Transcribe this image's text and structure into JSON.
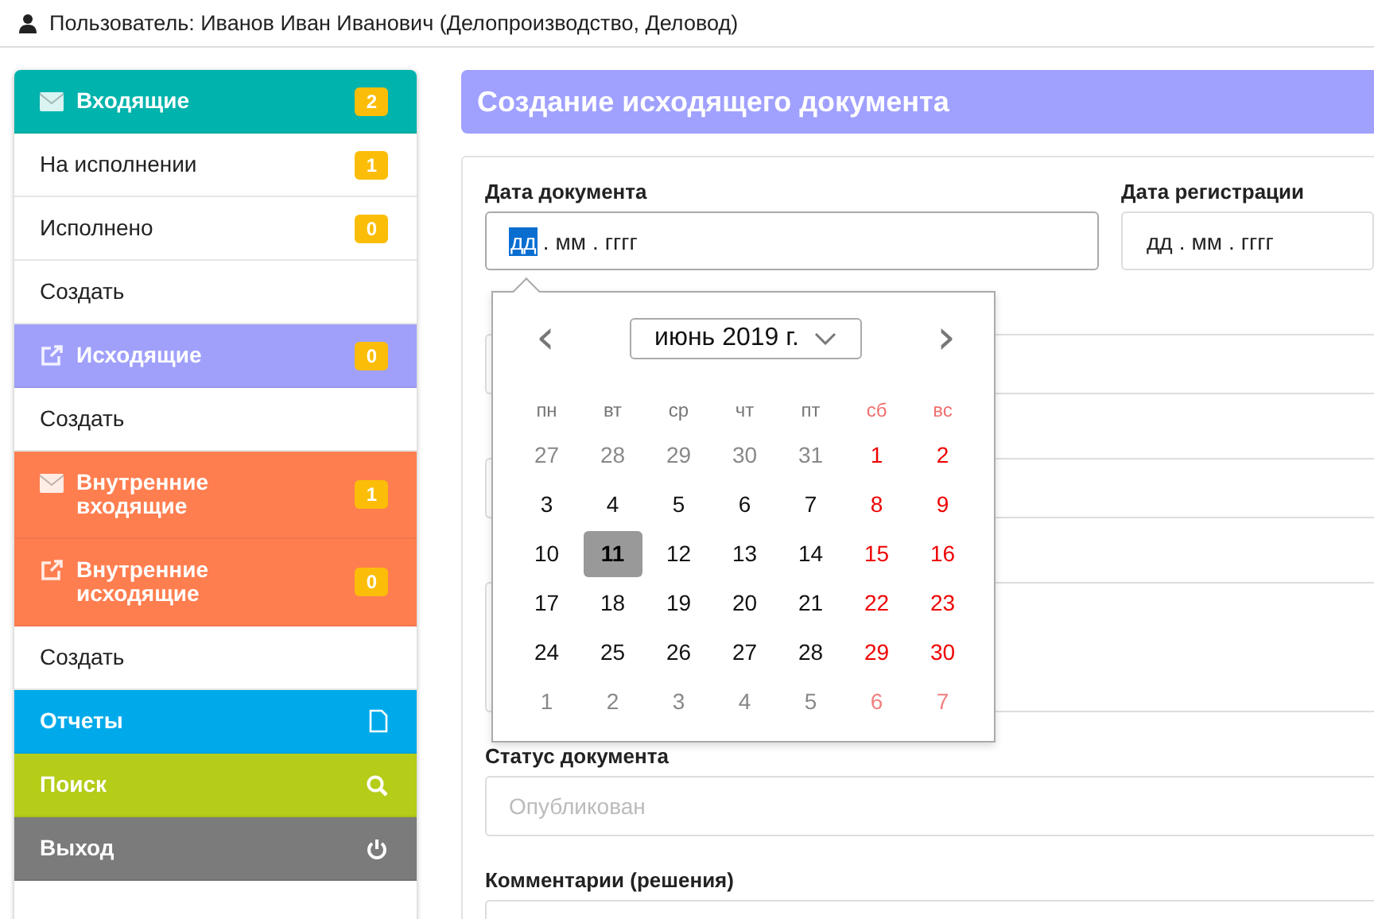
{
  "header": {
    "user_text": "Пользователь: Иванов Иван Иванович (Делопроизводство, Деловод)"
  },
  "sidebar": {
    "items": [
      {
        "label": "Входящие",
        "kind": "section",
        "color": "#00b3ad",
        "badge": "2"
      },
      {
        "label": "На исполнении",
        "kind": "link",
        "badge": "1"
      },
      {
        "label": "Исполнено",
        "kind": "link",
        "badge": "0"
      },
      {
        "label": "Создать",
        "kind": "link"
      },
      {
        "label": "Исходящие",
        "kind": "section",
        "color": "#a0a0fb",
        "badge": "0"
      },
      {
        "label": "Создать",
        "kind": "link"
      },
      {
        "label": "Внутренние входящие",
        "kind": "section",
        "color": "#ff7e50",
        "badge": "1"
      },
      {
        "label": "Внутренние исходящие",
        "kind": "section",
        "color": "#ff7e50",
        "badge": "0"
      },
      {
        "label": "Создать",
        "kind": "link"
      },
      {
        "label": "Отчеты",
        "kind": "tool",
        "color": "#00aaea"
      },
      {
        "label": "Поиск",
        "kind": "tool",
        "color": "#b5cc18"
      },
      {
        "label": "Выход",
        "kind": "tool",
        "color": "#7b7b7b"
      }
    ]
  },
  "main": {
    "title": "Создание исходящего документа",
    "date_fields": [
      {
        "label": "Дата документа",
        "focused": true,
        "separator": ".",
        "segments": [
          {
            "text": "дд",
            "selected": true
          },
          {
            "text": "мм",
            "selected": false
          },
          {
            "text": "гггг",
            "selected": false
          }
        ]
      },
      {
        "label": "Дата регистрации",
        "focused": false,
        "separator": ".",
        "segments": [
          {
            "text": "дд",
            "selected": false
          },
          {
            "text": "мм",
            "selected": false
          },
          {
            "text": "гггг",
            "selected": false
          }
        ]
      }
    ],
    "fields": [
      {
        "kind": "input"
      },
      {
        "kind": "input"
      },
      {
        "kind": "textarea"
      },
      {
        "label": "Статус документа",
        "kind": "input",
        "placeholder": "Опубликован"
      },
      {
        "label": "Комментарии (решения)",
        "kind": "input"
      }
    ]
  },
  "date_picker": {
    "month": "июнь 2019 г.",
    "prev": "‹",
    "next": "›",
    "weekdays": [
      {
        "label": "пн",
        "weekend": false
      },
      {
        "label": "вт",
        "weekend": false
      },
      {
        "label": "ср",
        "weekend": false
      },
      {
        "label": "чт",
        "weekend": false
      },
      {
        "label": "пт",
        "weekend": false
      },
      {
        "label": "сб",
        "weekend": true
      },
      {
        "label": "вс",
        "weekend": true
      }
    ],
    "weeks": [
      [
        {
          "day": "27",
          "muted": true,
          "selected": false
        },
        {
          "day": "28",
          "muted": true,
          "selected": false
        },
        {
          "day": "29",
          "muted": true,
          "selected": false
        },
        {
          "day": "30",
          "muted": true,
          "selected": false
        },
        {
          "day": "31",
          "muted": true,
          "selected": false
        },
        {
          "day": "1",
          "muted": false,
          "selected": false
        },
        {
          "day": "2",
          "muted": false,
          "selected": false
        }
      ],
      [
        {
          "day": "3",
          "muted": false,
          "selected": false
        },
        {
          "day": "4",
          "muted": false,
          "selected": false
        },
        {
          "day": "5",
          "muted": false,
          "selected": false
        },
        {
          "day": "6",
          "muted": false,
          "selected": false
        },
        {
          "day": "7",
          "muted": false,
          "selected": false
        },
        {
          "day": "8",
          "muted": false,
          "selected": false
        },
        {
          "day": "9",
          "muted": false,
          "selected": false
        }
      ],
      [
        {
          "day": "10",
          "muted": false,
          "selected": false
        },
        {
          "day": "11",
          "muted": false,
          "selected": true
        },
        {
          "day": "12",
          "muted": false,
          "selected": false
        },
        {
          "day": "13",
          "muted": false,
          "selected": false
        },
        {
          "day": "14",
          "muted": false,
          "selected": false
        },
        {
          "day": "15",
          "muted": false,
          "selected": false
        },
        {
          "day": "16",
          "muted": false,
          "selected": false
        }
      ],
      [
        {
          "day": "17",
          "muted": false,
          "selected": false
        },
        {
          "day": "18",
          "muted": false,
          "selected": false
        },
        {
          "day": "19",
          "muted": false,
          "selected": false
        },
        {
          "day": "20",
          "muted": false,
          "selected": false
        },
        {
          "day": "21",
          "muted": false,
          "selected": false
        },
        {
          "day": "22",
          "muted": false,
          "selected": false
        },
        {
          "day": "23",
          "muted": false,
          "selected": false
        }
      ],
      [
        {
          "day": "24",
          "muted": false,
          "selected": false
        },
        {
          "day": "25",
          "muted": false,
          "selected": false
        },
        {
          "day": "26",
          "muted": false,
          "selected": false
        },
        {
          "day": "27",
          "muted": false,
          "selected": false
        },
        {
          "day": "28",
          "muted": false,
          "selected": false
        },
        {
          "day": "29",
          "muted": false,
          "selected": false
        },
        {
          "day": "30",
          "muted": false,
          "selected": false
        }
      ],
      [
        {
          "day": "1",
          "muted": true,
          "selected": false
        },
        {
          "day": "2",
          "muted": true,
          "selected": false
        },
        {
          "day": "3",
          "muted": true,
          "selected": false
        },
        {
          "day": "4",
          "muted": true,
          "selected": false
        },
        {
          "day": "5",
          "muted": true,
          "selected": false
        },
        {
          "day": "6",
          "muted": true,
          "selected": false
        },
        {
          "day": "7",
          "muted": true,
          "selected": false
        }
      ]
    ]
  }
}
